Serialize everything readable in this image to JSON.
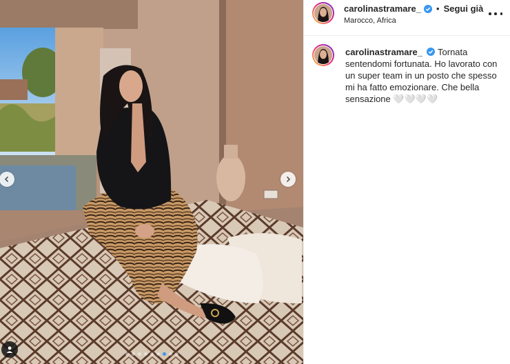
{
  "post": {
    "username": "carolinastramare_",
    "follow_label": "Segui già",
    "bullet": "•",
    "location": "Marocco, Africa",
    "caption": "Tornata sentendomi fortunata. Ho lavorato con un super team in un posto che spesso mi ha fatto emozionare. Che bella sensazione 🤍🤍🤍🤍"
  },
  "icons": {
    "verified": "verified-badge-icon",
    "more": "more-options-icon",
    "prev": "chevron-left-icon",
    "next": "chevron-right-icon",
    "tag": "user-tag-icon"
  },
  "carousel": {
    "slides": 9,
    "active_index": 6
  },
  "colors": {
    "verified": "#3897f0",
    "accent_dot": "#3897f0",
    "text": "#262626"
  }
}
